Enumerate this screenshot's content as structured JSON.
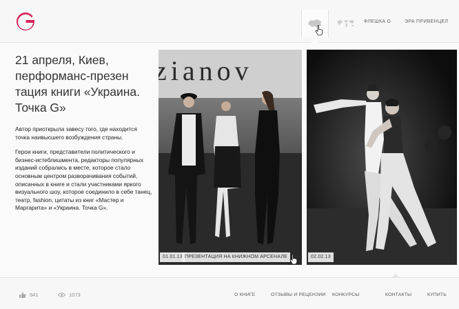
{
  "header": {
    "logo_letter": "G",
    "brand_color": "#d6245a",
    "nav_links": [
      "Флешка G",
      "Эра Привенцел"
    ]
  },
  "article": {
    "title": "21 апреля, Киев, перформанс-презен тация книги «Украина. Точка G»",
    "intro": "Автор приоткрыла завесу того, где находится точка наивысшего возбуждения страны.",
    "body": "Герои книги, представители политического и бизнес-истеблишмента, редакторы популярных изданий собрались в месте, которое стало основным центром разворачивания событий, описанных в книге и стали участниками яркого визуального шоу, которое соединило в себе танец, театр, fashion, цитаты из книг «Мастер и Маргарита» и «Украина. Точка G»."
  },
  "photos": [
    {
      "date": "01.01.13",
      "caption": "Презентация на книжном арсенале",
      "backdrop_text": "zianov"
    },
    {
      "date": "02.02.13",
      "caption": ""
    }
  ],
  "footer": {
    "likes": "541",
    "views": "1073",
    "links": [
      "О книге",
      "Отзывы и рецензии",
      "Конкурсы",
      "Контакты",
      "Купить"
    ]
  },
  "icons": {
    "ukraine_map": "ukraine-map-icon",
    "world_map": "world-map-icon",
    "like": "thumbs-up-icon",
    "views": "eye-icon",
    "cursor": "hand-cursor-icon"
  }
}
